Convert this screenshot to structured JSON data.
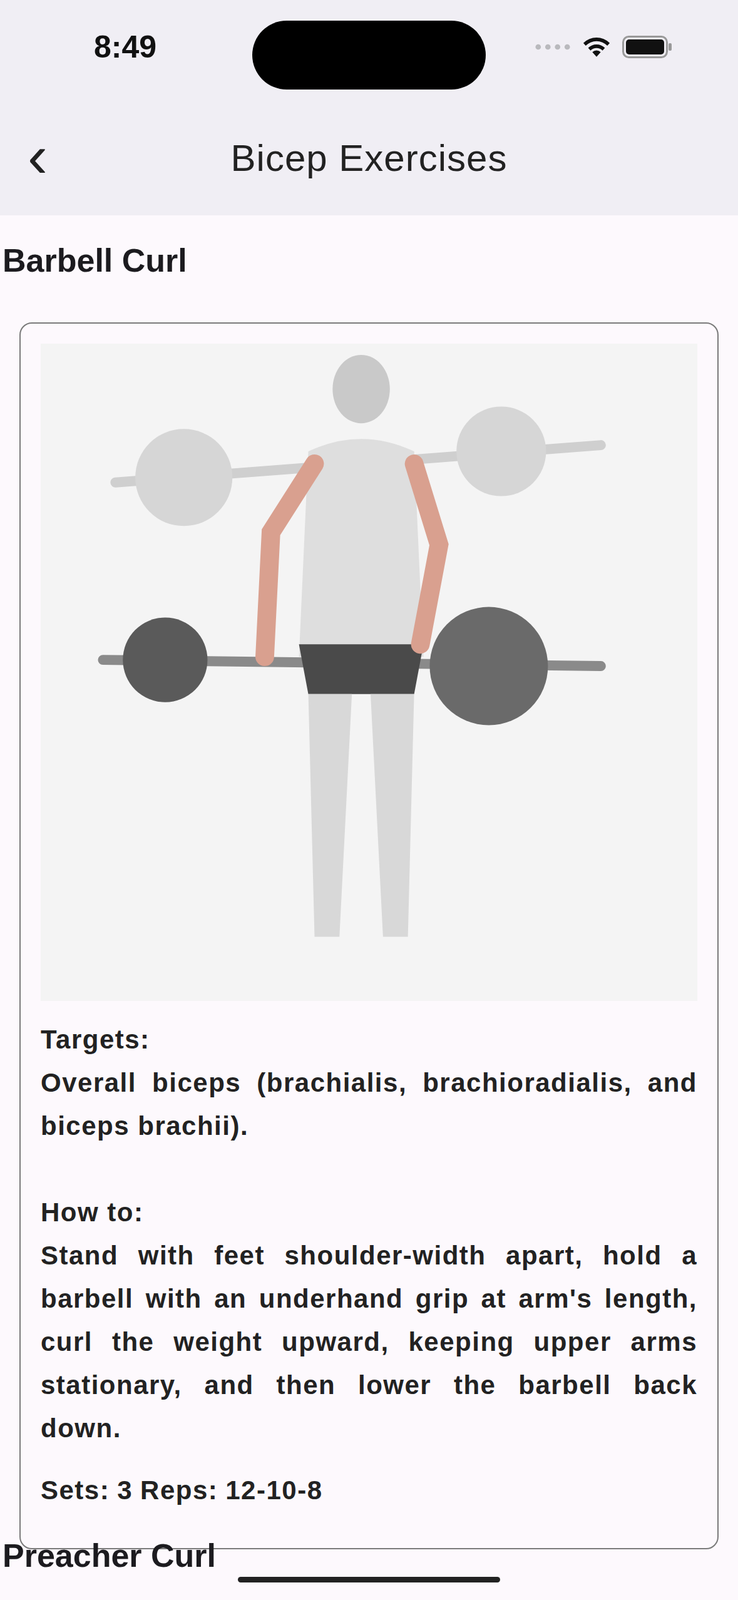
{
  "status_bar": {
    "time": "8:49"
  },
  "nav": {
    "back_icon": "‹",
    "title": "Bicep Exercises"
  },
  "exercises": [
    {
      "title": "Barbell Curl",
      "targets_label": "Targets:",
      "targets": "Overall biceps (brachialis, brachioradialis, and biceps brachii).",
      "howto_label": "How to:",
      "howto": "Stand with feet shoulder-width apart, hold a barbell with an underhand grip at arm's length, curl the weight upward, keeping upper arms stationary, and then lower the barbell back down.",
      "sets_label": "Sets:",
      "sets": "3",
      "reps_label": "Reps:",
      "reps": "12-10-8"
    },
    {
      "title": "Preacher Curl"
    }
  ]
}
